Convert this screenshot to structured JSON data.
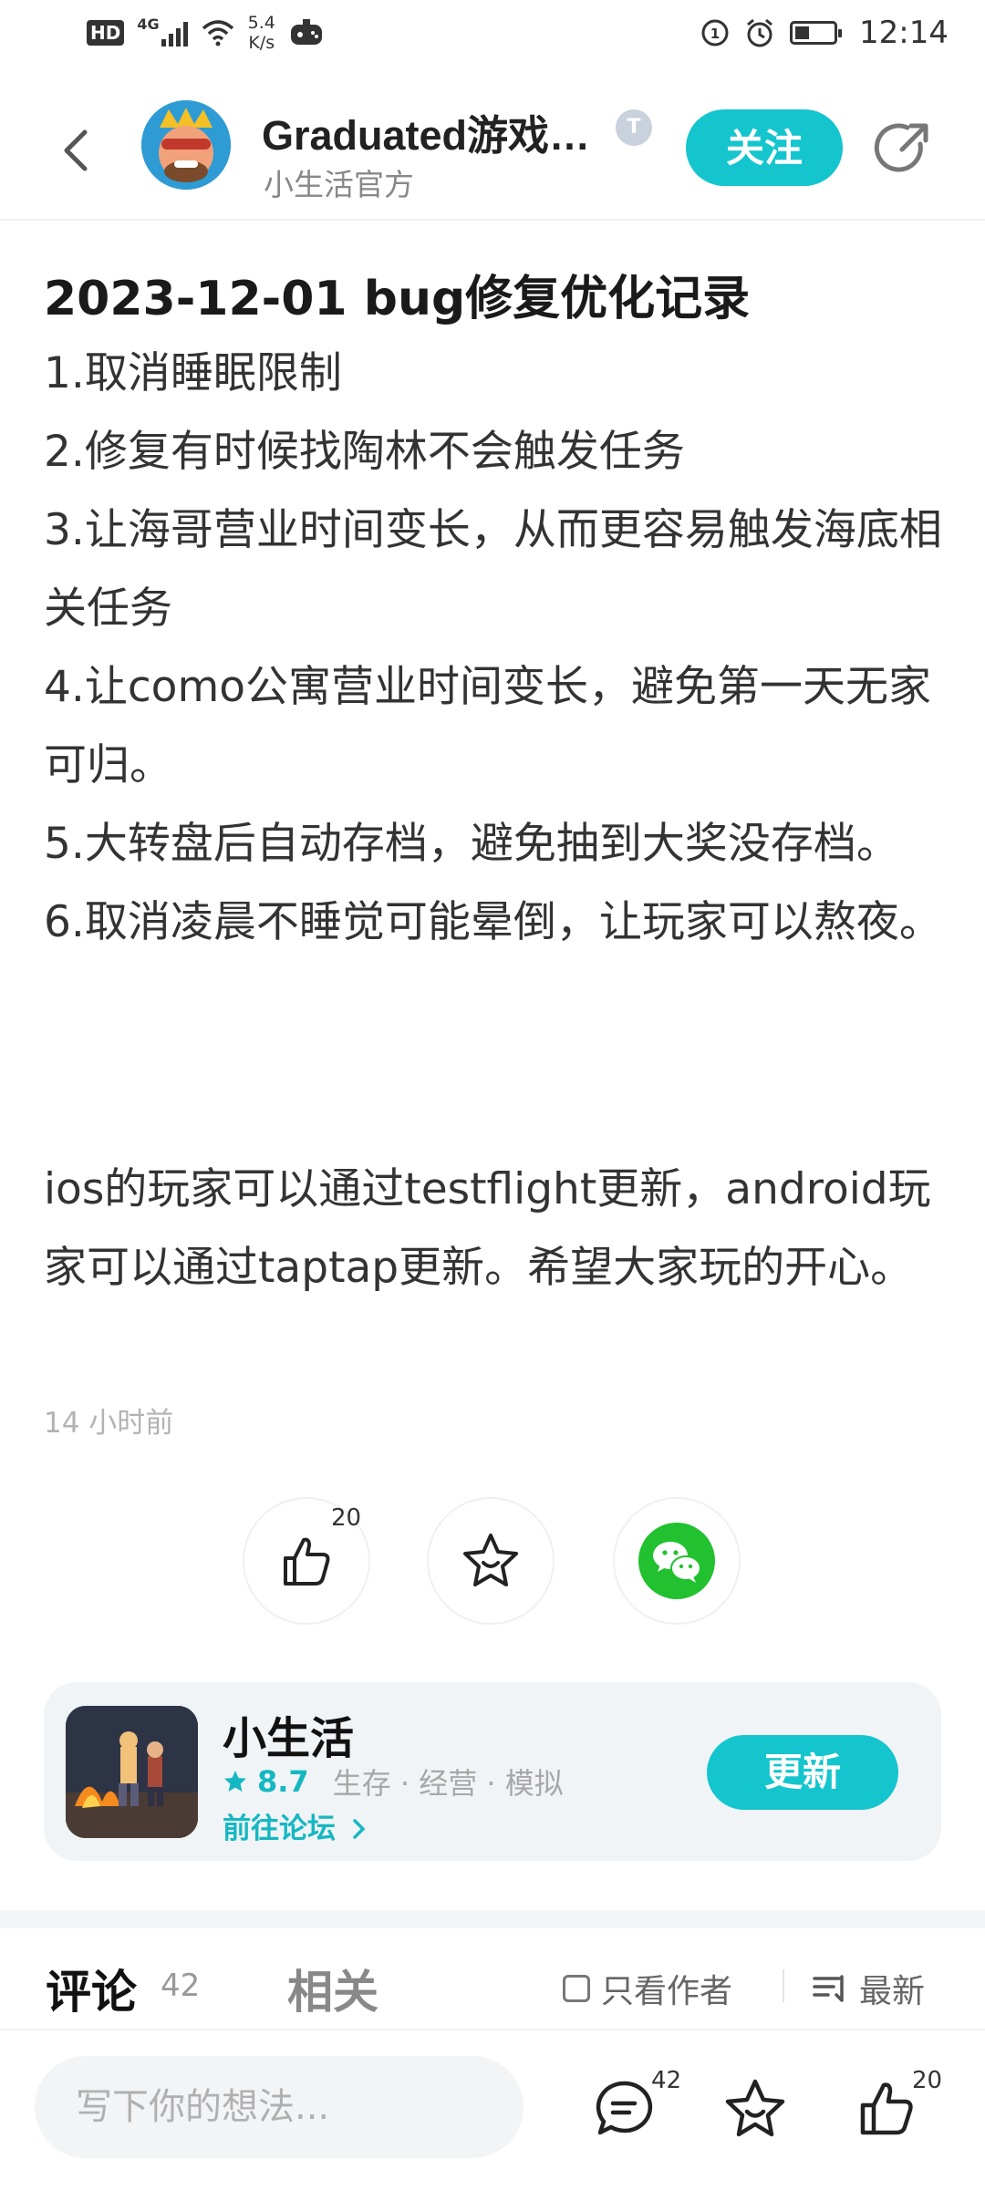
{
  "status_bar": {
    "hd": "HD",
    "network": "4G",
    "speed_value": "5.4",
    "speed_unit": "K/s",
    "time": "12:14"
  },
  "header": {
    "name": "Graduated游戏…",
    "subtitle": "小生活官方",
    "badge": "T",
    "follow_label": "关注"
  },
  "article": {
    "title": "2023-12-01 bug修复优化记录",
    "lines": [
      "1.取消睡眠限制",
      "2.修复有时候找陶林不会触发任务",
      "3.让海哥营业时间变长，从而更容易触发海底相关任务",
      "4.让como公寓营业时间变长，避免第一天无家可归。",
      "5.大转盘后自动存档，避免抽到大奖没存档。",
      "6.取消凌晨不睡觉可能晕倒，让玩家可以熬夜。"
    ],
    "note": "ios的玩家可以通过testflight更新，android玩家可以通过taptap更新。希望大家玩的开心。",
    "timestamp": "14 小时前"
  },
  "actions": {
    "like_count": "20"
  },
  "app_card": {
    "name": "小生活",
    "rating": "8.7",
    "tags": "生存 · 经营 · 模拟",
    "forum_link": "前往论坛",
    "update_label": "更新"
  },
  "tabs": {
    "comments_label": "评论",
    "comments_count": "42",
    "related_label": "相关",
    "author_only_label": "只看作者",
    "sort_label": "最新"
  },
  "bottom_bar": {
    "input_placeholder": "写下你的想法...",
    "comment_count": "42",
    "like_count": "20"
  },
  "colors": {
    "accent": "#15c5ce",
    "wechat": "#21c12f"
  },
  "icons": [
    "back-arrow-icon",
    "share-icon",
    "thumbs-up-icon",
    "star-icon",
    "wechat-icon",
    "comment-icon",
    "sort-icon",
    "chevron-right-icon"
  ]
}
